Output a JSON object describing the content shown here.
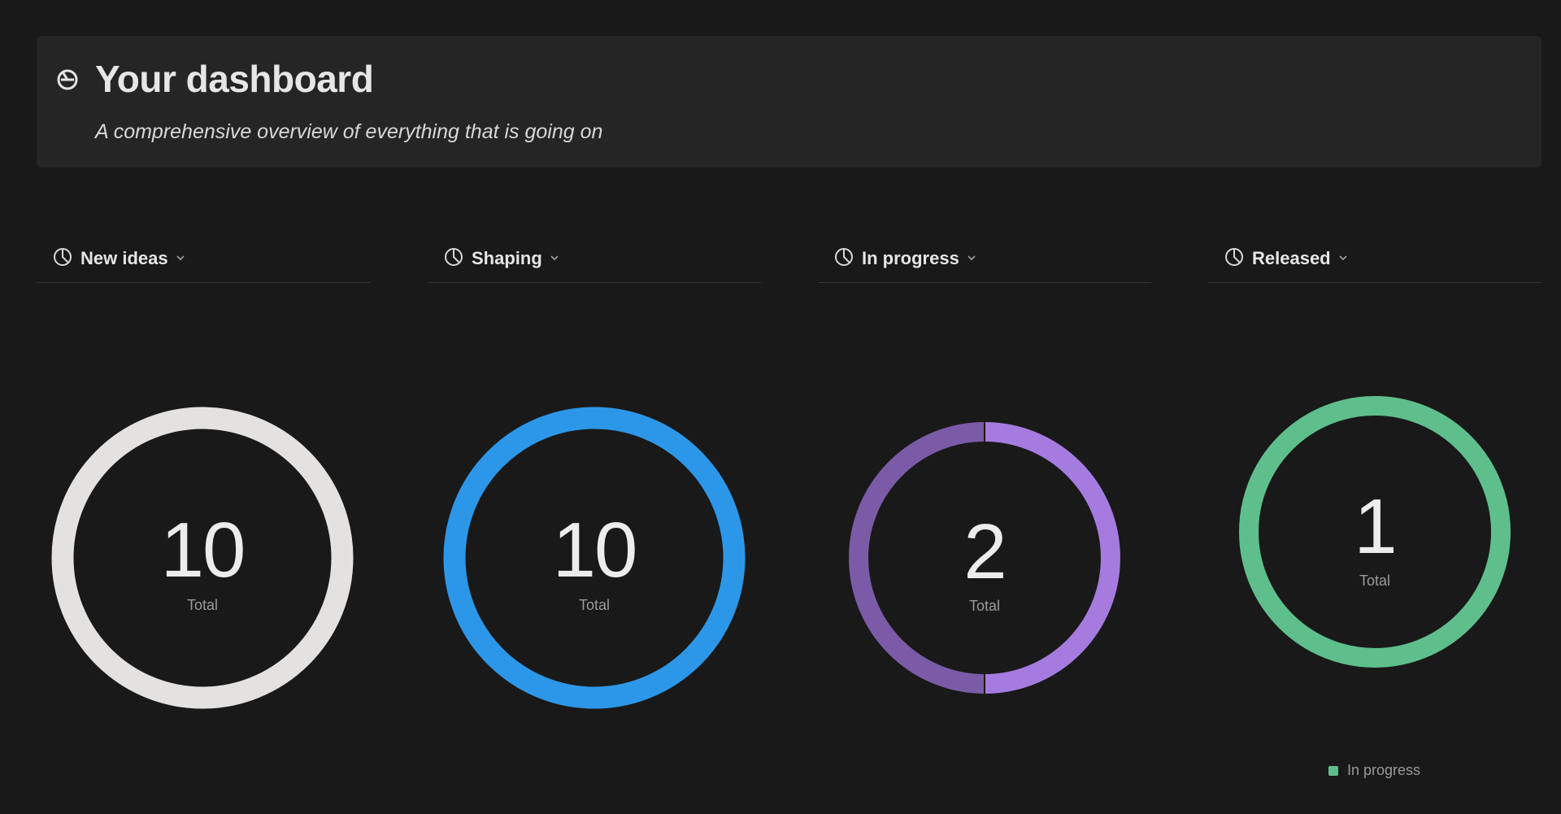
{
  "header": {
    "title": "Your dashboard",
    "subtitle": "A comprehensive overview of everything that is going on",
    "icon": "pie-chart-icon"
  },
  "colors": {
    "background": "#191919",
    "card": "#252525",
    "new_ideas": "#e3e2e0",
    "shaping": "#2c97e8",
    "in_progress_a": "#a57be0",
    "in_progress_b": "#7b5ba8",
    "released": "#5fbf8c"
  },
  "chart_data": [
    {
      "type": "pie",
      "title": "New ideas",
      "total": "10",
      "total_label": "Total",
      "segments": [
        {
          "value": 10,
          "color": "#e3e2e0"
        }
      ]
    },
    {
      "type": "pie",
      "title": "Shaping",
      "total": "10",
      "total_label": "Total",
      "segments": [
        {
          "value": 10,
          "color": "#2c97e8"
        }
      ]
    },
    {
      "type": "pie",
      "title": "In progress",
      "total": "2",
      "total_label": "Total",
      "segments": [
        {
          "value": 1,
          "color": "#a57be0"
        },
        {
          "value": 1,
          "color": "#7b5ba8"
        }
      ]
    },
    {
      "type": "pie",
      "title": "Released",
      "total": "1",
      "total_label": "Total",
      "segments": [
        {
          "value": 1,
          "color": "#5fbf8c"
        }
      ],
      "legend": [
        {
          "label": "In progress",
          "color": "#5fbf8c"
        }
      ],
      "legend_position": "bottom"
    }
  ]
}
